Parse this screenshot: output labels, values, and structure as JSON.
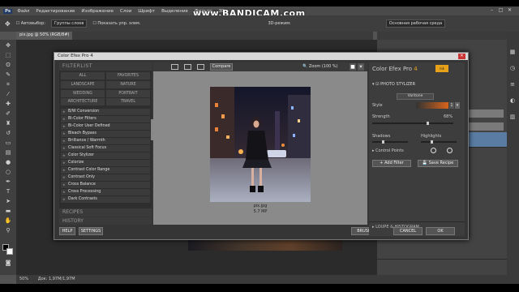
{
  "watermark": "www.BANDICAM.com",
  "menu": [
    "Ps",
    "Файл",
    "Редактирование",
    "Изображение",
    "Слои",
    "Шрифт",
    "Выделение",
    "Фильтр",
    "3D"
  ],
  "options": {
    "autoselect": "Автовыбор:",
    "group": "Группы слоев",
    "show_controls": "Показать упр. элем.",
    "mode3d": "3D-режим:",
    "workspace": "Основная рабочая среда"
  },
  "doc_tab": "pix.jpg @ 50% (RGB/8#)",
  "status": {
    "zoom": "50%",
    "doc": "Док: 1,97M/1,97M"
  },
  "dialog": {
    "title": "Color Efex Pro 4",
    "filterlist_head": "FILTERLIST",
    "categories": [
      "ALL",
      "FAVORITES",
      "LANDSCAPE",
      "NATURE",
      "WEDDING",
      "PORTRAIT",
      "ARCHITECTURE",
      "TRAVEL"
    ],
    "filters": [
      "B/W Conversion",
      "Bi-Color Filters",
      "Bi-Color User Defined",
      "Bleach Bypass",
      "Brilliance / Warmth",
      "Classical Soft Focus",
      "Color Stylizer",
      "Colorize",
      "Contrast Color Range",
      "Contrast Only",
      "Cross Balance",
      "Cross Processing",
      "Dark Contrasts"
    ],
    "recipes": "RECIPES",
    "history": "HISTORY",
    "help": "HELP",
    "settings": "SETTINGS",
    "compare": "Compare",
    "zoom": "Zoom (100 %)",
    "file_name": "pix.jpg",
    "file_size": "5.7 MP",
    "brush": "BRUSH",
    "cancel": "CANCEL",
    "ok": "OK"
  },
  "panel": {
    "title_main": "Color Efex Pro",
    "title_ver": "4",
    "filter_name": "PHOTO STYLIZER",
    "variant": "Varitone",
    "style_label": "Style",
    "style_value": "1",
    "strength_label": "Strength",
    "strength_value": "68%",
    "strength_level": 0.68,
    "shadows_label": "Shadows",
    "highlights_label": "Highlights",
    "control_points": "Control Points",
    "add_filter": "Add Filter",
    "save_recipe": "Save Recipe",
    "loupe": "LOUPE & HISTOGRAM"
  },
  "colors": {
    "accent": "#e7a21a",
    "style_bar": "#d9641c"
  }
}
